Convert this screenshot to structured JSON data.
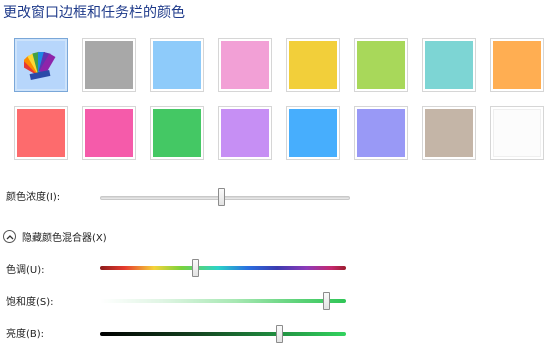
{
  "window": {
    "title": "更改窗口边框和任务栏的颜色"
  },
  "swatches": [
    {
      "color": "#b7d6fb",
      "selected": true,
      "icon": "color-palette-icon"
    },
    {
      "color": "#a8a8a8"
    },
    {
      "color": "#8ecbfa"
    },
    {
      "color": "#f2a0d6"
    },
    {
      "color": "#f2cf3a"
    },
    {
      "color": "#a8d85a"
    },
    {
      "color": "#7dd5d4"
    },
    {
      "color": "#ffae52"
    },
    {
      "color": "#fd6b6d"
    },
    {
      "color": "#f55baa"
    },
    {
      "color": "#44c864"
    },
    {
      "color": "#c68ff4"
    },
    {
      "color": "#47aefd"
    },
    {
      "color": "#9999f6"
    },
    {
      "color": "#c4b5a7"
    },
    {
      "color": "#fcfcfc"
    }
  ],
  "intensity": {
    "label": "颜色浓度(I):",
    "value": 0.49
  },
  "mixer": {
    "toggle_label": "隐藏颜色混合器(X)",
    "hue": {
      "label": "色调(U):",
      "value": 0.39
    },
    "saturation": {
      "label": "饱和度(S):",
      "value": 0.92
    },
    "brightness": {
      "label": "亮度(B):",
      "value": 0.73
    }
  }
}
